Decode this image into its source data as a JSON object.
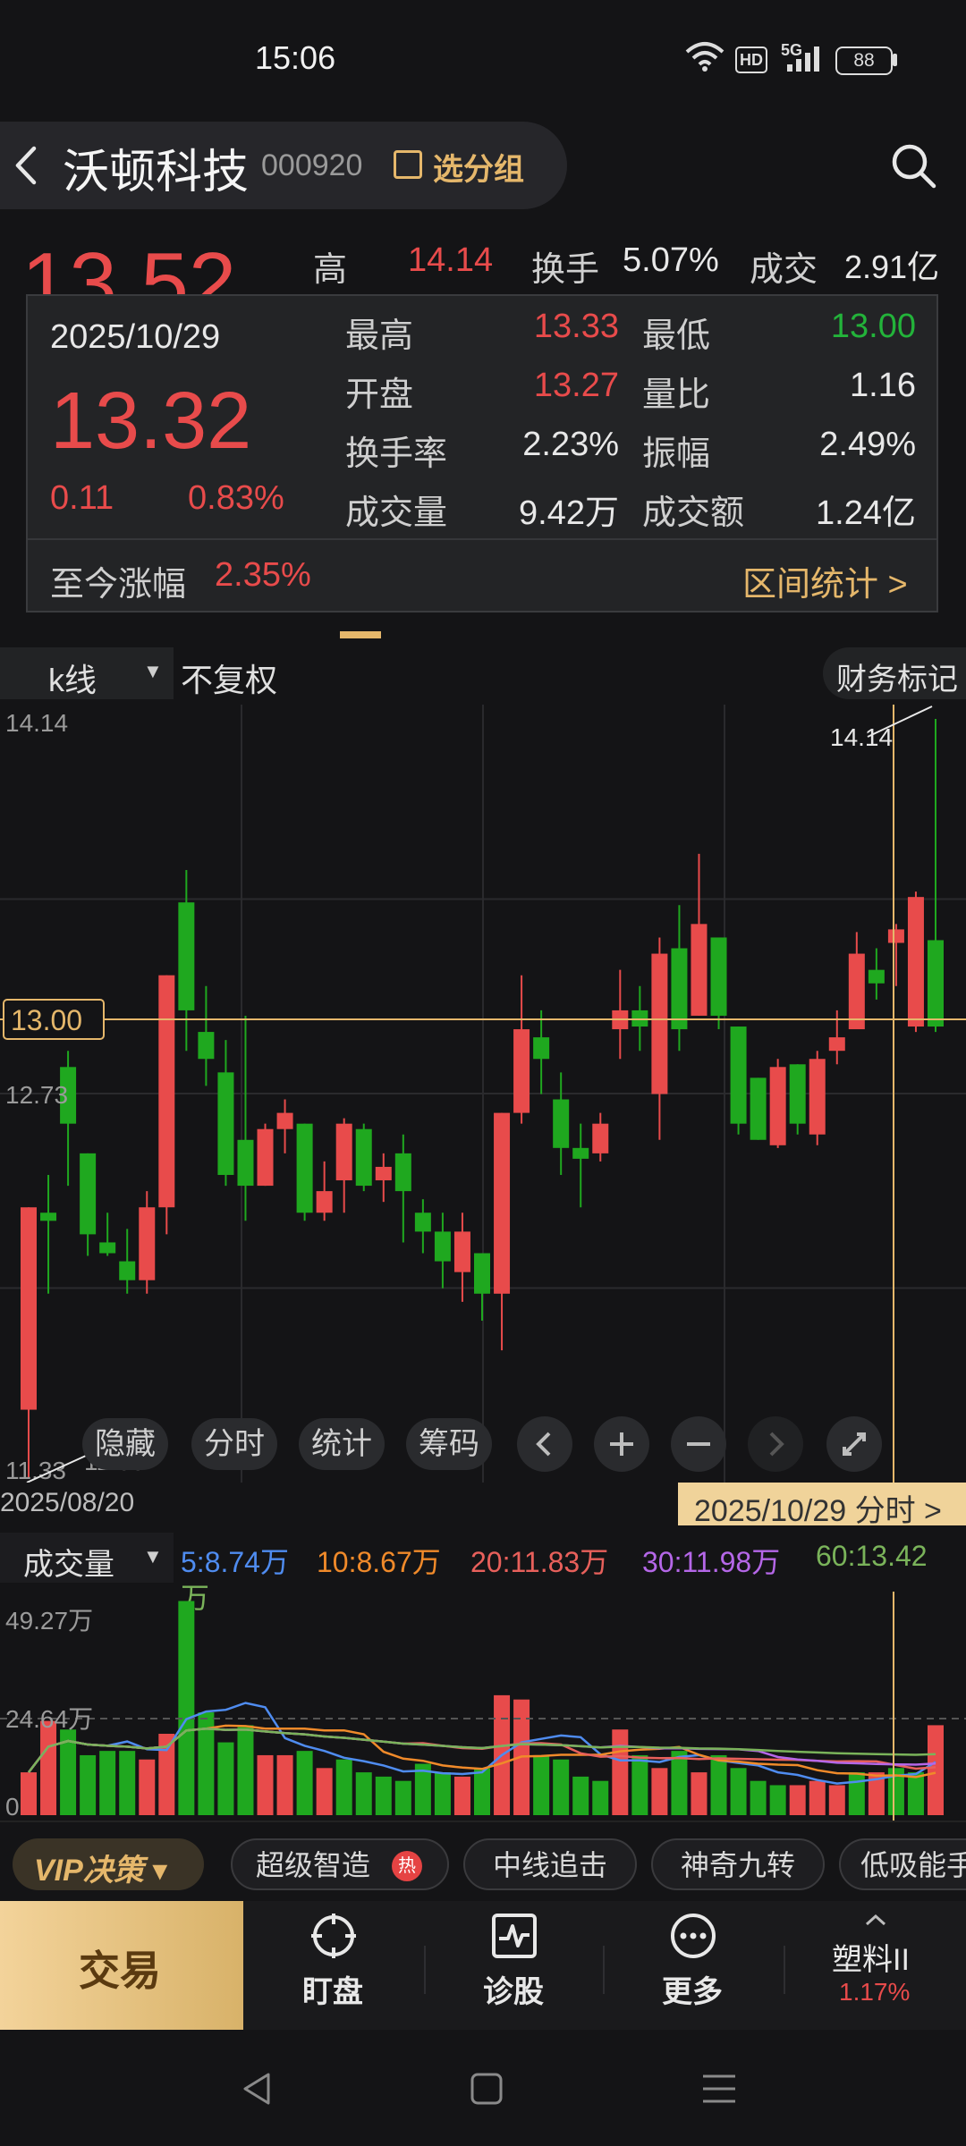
{
  "status_bar": {
    "time": "15:06",
    "hd": "HD",
    "signal": "5G",
    "battery": "88"
  },
  "header": {
    "stock_name": "沃顿科技",
    "stock_code": "000920",
    "group_label": "选分组"
  },
  "quote": {
    "price": "13.52",
    "high_label": "高",
    "high_value": "14.14",
    "turnover_label": "换手",
    "turnover_value": "5.07%",
    "amount_label": "成交",
    "amount_value": "2.91亿"
  },
  "popup": {
    "date": "2025/10/29",
    "close": "13.32",
    "change": "0.11",
    "change_pct": "0.83%",
    "rows": [
      {
        "l1": "最高",
        "v1": "13.33",
        "c1": "red",
        "l2": "最低",
        "v2": "13.00",
        "c2": "green"
      },
      {
        "l1": "开盘",
        "v1": "13.27",
        "c1": "red",
        "l2": "量比",
        "v2": "1.16",
        "c2": "white"
      },
      {
        "l1": "换手率",
        "v1": "2.23%",
        "c1": "white",
        "l2": "振幅",
        "v2": "2.49%",
        "c2": "white"
      },
      {
        "l1": "成交量",
        "v1": "9.42万",
        "c1": "white",
        "l2": "成交额",
        "v2": "1.24亿",
        "c2": "white"
      }
    ],
    "since_label": "至今涨幅",
    "since_value": "2.35%",
    "range_stats": "区间统计 >"
  },
  "kline_toolbar": {
    "kline": "k线",
    "adjust": "不复权",
    "fin_mark": "财务标记"
  },
  "chart_data": [
    {
      "type": "candlestick",
      "title": "",
      "y_labels": [
        "14.14",
        "12.73",
        "11.33"
      ],
      "crosshair_value": "13.00",
      "high_marker": "14.14",
      "low_marker": "11.33",
      "x_start_label": "2025/08/20",
      "x_end_label": "2025/10/29",
      "ylim": [
        11.33,
        14.14
      ],
      "candles": [
        {
          "o": 11.58,
          "c": 12.33,
          "h": 12.33,
          "l": 11.33
        },
        {
          "o": 12.31,
          "c": 12.28,
          "h": 12.45,
          "l": 12.01
        },
        {
          "o": 12.85,
          "c": 12.64,
          "h": 12.91,
          "l": 12.41
        },
        {
          "o": 12.53,
          "c": 12.23,
          "h": 12.53,
          "l": 12.15
        },
        {
          "o": 12.2,
          "c": 12.16,
          "h": 12.31,
          "l": 12.15
        },
        {
          "o": 12.13,
          "c": 12.06,
          "h": 12.25,
          "l": 12.01
        },
        {
          "o": 12.06,
          "c": 12.33,
          "h": 12.39,
          "l": 12.01
        },
        {
          "o": 12.33,
          "c": 13.19,
          "h": 13.19,
          "l": 12.23
        },
        {
          "o": 13.46,
          "c": 13.06,
          "h": 13.58,
          "l": 12.91
        },
        {
          "o": 12.98,
          "c": 12.88,
          "h": 13.15,
          "l": 12.78
        },
        {
          "o": 12.83,
          "c": 12.45,
          "h": 12.95,
          "l": 12.41
        },
        {
          "o": 12.58,
          "c": 12.41,
          "h": 13.04,
          "l": 12.28
        },
        {
          "o": 12.41,
          "c": 12.62,
          "h": 12.64,
          "l": 12.41
        },
        {
          "o": 12.62,
          "c": 12.68,
          "h": 12.73,
          "l": 12.53
        },
        {
          "o": 12.64,
          "c": 12.31,
          "h": 12.64,
          "l": 12.28
        },
        {
          "o": 12.31,
          "c": 12.39,
          "h": 12.5,
          "l": 12.28
        },
        {
          "o": 12.43,
          "c": 12.64,
          "h": 12.66,
          "l": 12.31
        },
        {
          "o": 12.62,
          "c": 12.41,
          "h": 12.64,
          "l": 12.39
        },
        {
          "o": 12.43,
          "c": 12.48,
          "h": 12.53,
          "l": 12.35
        },
        {
          "o": 12.53,
          "c": 12.39,
          "h": 12.6,
          "l": 12.2
        },
        {
          "o": 12.31,
          "c": 12.24,
          "h": 12.36,
          "l": 12.16
        },
        {
          "o": 12.24,
          "c": 12.13,
          "h": 12.31,
          "l": 12.03
        },
        {
          "o": 12.09,
          "c": 12.24,
          "h": 12.31,
          "l": 11.98
        },
        {
          "o": 12.16,
          "c": 12.01,
          "h": 12.16,
          "l": 11.91
        },
        {
          "o": 12.01,
          "c": 12.68,
          "h": 12.68,
          "l": 11.8
        },
        {
          "o": 12.68,
          "c": 12.99,
          "h": 13.19,
          "l": 12.64
        },
        {
          "o": 12.96,
          "c": 12.88,
          "h": 13.06,
          "l": 12.75
        },
        {
          "o": 12.73,
          "c": 12.55,
          "h": 12.83,
          "l": 12.45
        },
        {
          "o": 12.55,
          "c": 12.51,
          "h": 12.64,
          "l": 12.33
        },
        {
          "o": 12.53,
          "c": 12.64,
          "h": 12.68,
          "l": 12.5
        },
        {
          "o": 12.99,
          "c": 13.06,
          "h": 13.21,
          "l": 12.88
        },
        {
          "o": 13.06,
          "c": 13.0,
          "h": 13.15,
          "l": 12.91
        },
        {
          "o": 12.75,
          "c": 13.27,
          "h": 13.33,
          "l": 12.58
        },
        {
          "o": 13.29,
          "c": 12.99,
          "h": 13.45,
          "l": 12.91
        },
        {
          "o": 13.04,
          "c": 13.38,
          "h": 13.64,
          "l": 13.04
        },
        {
          "o": 13.33,
          "c": 13.04,
          "h": 13.33,
          "l": 12.99
        },
        {
          "o": 13.0,
          "c": 12.64,
          "h": 13.0,
          "l": 12.6
        },
        {
          "o": 12.81,
          "c": 12.58,
          "h": 12.81,
          "l": 12.58
        },
        {
          "o": 12.56,
          "c": 12.85,
          "h": 12.88,
          "l": 12.55
        },
        {
          "o": 12.86,
          "c": 12.64,
          "h": 12.86,
          "l": 12.6
        },
        {
          "o": 12.6,
          "c": 12.88,
          "h": 12.91,
          "l": 12.56
        },
        {
          "o": 12.91,
          "c": 12.96,
          "h": 13.06,
          "l": 12.86
        },
        {
          "o": 12.99,
          "c": 13.27,
          "h": 13.35,
          "l": 12.99
        },
        {
          "o": 13.21,
          "c": 13.16,
          "h": 13.29,
          "l": 13.1
        },
        {
          "o": 13.31,
          "c": 13.36,
          "h": 13.38,
          "l": 13.15
        },
        {
          "o": 13.0,
          "c": 13.48,
          "h": 13.5,
          "l": 12.98
        },
        {
          "o": 13.32,
          "c": 13.0,
          "h": 14.14,
          "l": 12.98
        }
      ]
    },
    {
      "type": "bar",
      "title": "",
      "y_labels": [
        "49.27万",
        "24.64万",
        "0"
      ],
      "ylim": [
        0,
        49.27
      ],
      "values": [
        10,
        22,
        20,
        14,
        15,
        15,
        13,
        19,
        50,
        24,
        17,
        21,
        14,
        14,
        15,
        11,
        13,
        10,
        9,
        8,
        12,
        10,
        9,
        11,
        28,
        27,
        14,
        13,
        9,
        8,
        20,
        14,
        11,
        15,
        10,
        14,
        11,
        8,
        7,
        7,
        8,
        7,
        10,
        10,
        11,
        10,
        21
      ],
      "colors": [
        "r",
        "r",
        "g",
        "g",
        "g",
        "g",
        "r",
        "r",
        "g",
        "g",
        "g",
        "g",
        "r",
        "r",
        "g",
        "r",
        "g",
        "g",
        "g",
        "g",
        "g",
        "g",
        "r",
        "g",
        "r",
        "r",
        "g",
        "g",
        "g",
        "g",
        "r",
        "g",
        "r",
        "g",
        "r",
        "g",
        "g",
        "g",
        "g",
        "r",
        "r",
        "r",
        "g",
        "r",
        "g",
        "g",
        "r"
      ]
    }
  ],
  "chart_buttons": [
    "隐藏",
    "分时",
    "统计",
    "筹码"
  ],
  "date_badge": "2025/10/29 分时 >",
  "volume": {
    "label": "成交量",
    "ma": [
      {
        "text": "5:8.74万",
        "color": "#4f8cf0"
      },
      {
        "text": "10:8.67万",
        "color": "#f08a2a"
      },
      {
        "text": "20:11.83万",
        "color": "#e8605b"
      },
      {
        "text": "30:11.98万",
        "color": "#b567e8"
      },
      {
        "text": "60:13.42",
        "color": "#7ab35a"
      },
      {
        "text": "万",
        "color": "#7ab35a"
      }
    ]
  },
  "tags": {
    "vip": "VIP决策",
    "items": [
      "超级智造",
      "中线追击",
      "神奇九转",
      "低吸能手"
    ],
    "hot": "热"
  },
  "actions": {
    "trade": "交易",
    "watch": "盯盘",
    "diagnose": "诊股",
    "more": "更多",
    "sector": "塑料II",
    "sector_pct": "1.17%"
  }
}
